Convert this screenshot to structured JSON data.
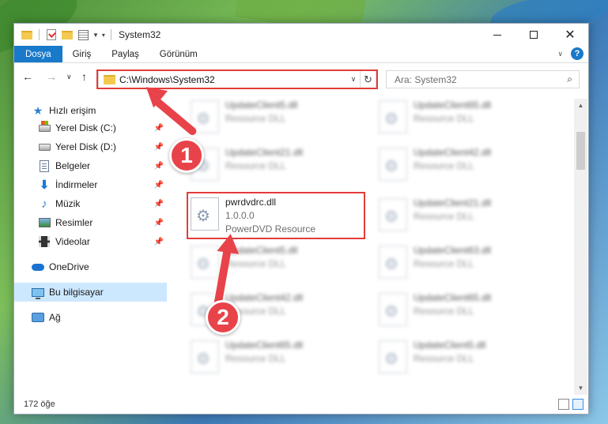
{
  "window": {
    "title": "System32"
  },
  "ribbon": {
    "tabs": [
      "Dosya",
      "Giriş",
      "Paylaş",
      "Görünüm"
    ],
    "help_label": "?"
  },
  "address": {
    "path": "C:\\Windows\\System32",
    "search_placeholder": "Ara: System32"
  },
  "sidebar": {
    "quick_access": "Hızlı erişim",
    "items": [
      {
        "label": "Yerel Disk (C:)",
        "icon": "drive-c-icon"
      },
      {
        "label": "Yerel Disk (D:)",
        "icon": "drive-icon"
      },
      {
        "label": "Belgeler",
        "icon": "documents-icon"
      },
      {
        "label": "İndirmeler",
        "icon": "downloads-icon"
      },
      {
        "label": "Müzik",
        "icon": "music-icon"
      },
      {
        "label": "Resimler",
        "icon": "pictures-icon"
      },
      {
        "label": "Videolar",
        "icon": "videos-icon"
      }
    ],
    "onedrive": "OneDrive",
    "this_pc": "Bu bilgisayar",
    "network": "Ağ"
  },
  "files": {
    "left": [
      {
        "name": "UpdateClient5.dll",
        "sub": "Resource DLL"
      },
      {
        "name": "UpdateClient21.dll",
        "sub": "Resource DLL"
      },
      {
        "name": "pwrdvdrc.dll",
        "sub": "1.0.0.0",
        "sub2": "PowerDVD Resource"
      },
      {
        "name": "UpdateClient5.dll",
        "sub": "Resource DLL"
      },
      {
        "name": "UpdateClient42.dll",
        "sub": "Resource DLL"
      },
      {
        "name": "UpdateClient65.dll",
        "sub": "Resource DLL"
      }
    ],
    "right": [
      {
        "name": "UpdateClient65.dll",
        "sub": "Resource DLL"
      },
      {
        "name": "UpdateClient42.dll",
        "sub": "Resource DLL"
      },
      {
        "name": "UpdateClient21.dll",
        "sub": "Resource DLL"
      },
      {
        "name": "UpdateClient63.dll",
        "sub": "Resource DLL"
      },
      {
        "name": "UpdateClient65.dll",
        "sub": "Resource DLL"
      },
      {
        "name": "UpdateClient5.dll",
        "sub": "Resource DLL"
      }
    ]
  },
  "status": {
    "count": "172 öğe"
  },
  "annotations": {
    "step1": "1",
    "step2": "2",
    "color": "#e8434a"
  }
}
